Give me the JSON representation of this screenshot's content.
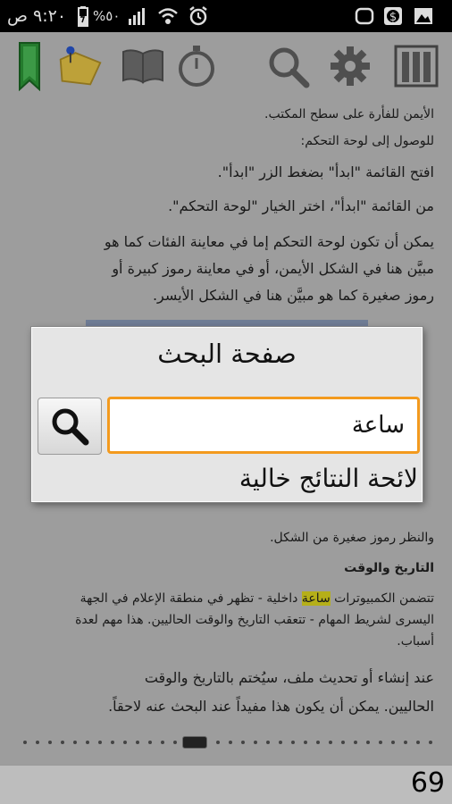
{
  "status_bar": {
    "time": "٩:٢٠ ص",
    "battery": "%٥٠",
    "icons": [
      "image-icon",
      "dollar-app-icon",
      "speech-bubble-icon",
      "alarm-icon",
      "wifi-icon",
      "signal-icon",
      "battery-icon"
    ]
  },
  "toolbar": {
    "icons": [
      "bookshelf-icon",
      "settings-gear-icon",
      "search-icon",
      "timer-icon",
      "open-book-icon",
      "folder-pin-icon",
      "bookmark-icon"
    ]
  },
  "book": {
    "lines": [
      "الأيمن للفأرة على سطح المكتب.",
      "للوصول إلى لوحة التحكم:",
      "افتح القائمة \"ابدأ\" بضغط الزر \"ابدأ\".",
      "من القائمة \"ابدأ\"، اختر الخيار \"لوحة التحكم\".",
      "يمكن أن تكون لوحة التحكم إما في معاينة الفئات كما هو",
      "مبيَّن هنا في الشكل الأيمن، أو في معاينة رموز كبيرة أو",
      "رموز صغيرة كما هو مبيَّن هنا في الشكل الأيسر.",
      "والنظر رموز صغيرة من الشكل.",
      "التاريخ والوقت",
      "تتضمن الكمبيوترات",
      "ساعة",
      "داخلية - تظهر في منطقة الإعلام في الجهة",
      "اليسرى لشريط المهام - تتعقب التاريخ والوقت الحاليين. هذا مهم لعدة",
      "أسباب.",
      "عند إنشاء أو تحديث ملف، سيُختم بالتاريخ والوقت",
      "الحاليين. يمكن أن يكون هذا مفيداً عند البحث عنه لاحقاً."
    ]
  },
  "dialog": {
    "title": "صفحة البحث",
    "search_value": "ساعة",
    "results_text": "لائحة النتائج خالية"
  },
  "page_number": "69"
}
